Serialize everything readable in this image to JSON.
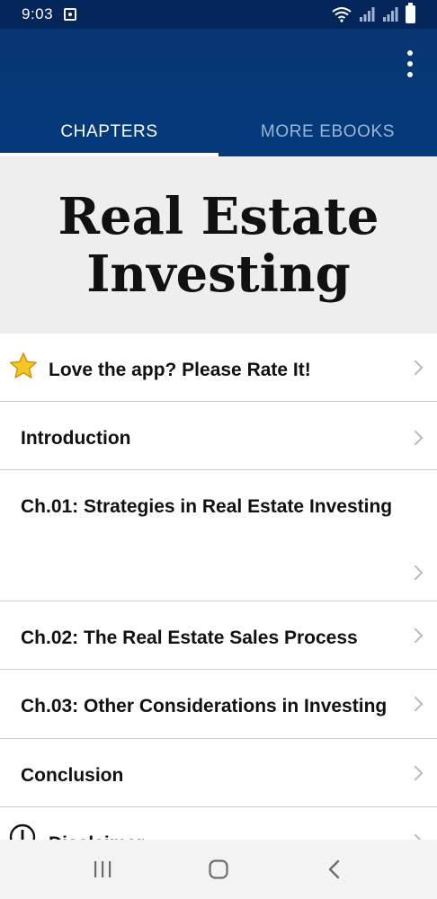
{
  "status_bar": {
    "time": "9:03"
  },
  "app_bar": {
    "tabs": [
      {
        "label": "CHAPTERS",
        "selected": true
      },
      {
        "label": "MORE EBOOKS",
        "selected": false
      }
    ]
  },
  "hero": {
    "title": "Real Estate Investing"
  },
  "chapters": [
    {
      "label": "Love the app? Please Rate It!",
      "icon": "star-icon"
    },
    {
      "label": "Introduction"
    },
    {
      "label": "Ch.01: Strategies in Real Estate Investing"
    },
    {
      "label": "Ch.02: The Real Estate Sales Process"
    },
    {
      "label": "Ch.03: Other Considerations in Investing"
    },
    {
      "label": "Conclusion"
    },
    {
      "label": "Disclaimer",
      "icon": "info-icon"
    }
  ],
  "colors": {
    "app_bar": "#043a7c",
    "status_bar": "#04255a",
    "hero_bg": "#eeeeee",
    "tab_inactive": "#9eb6d6",
    "divider": "#cfcfcf"
  }
}
